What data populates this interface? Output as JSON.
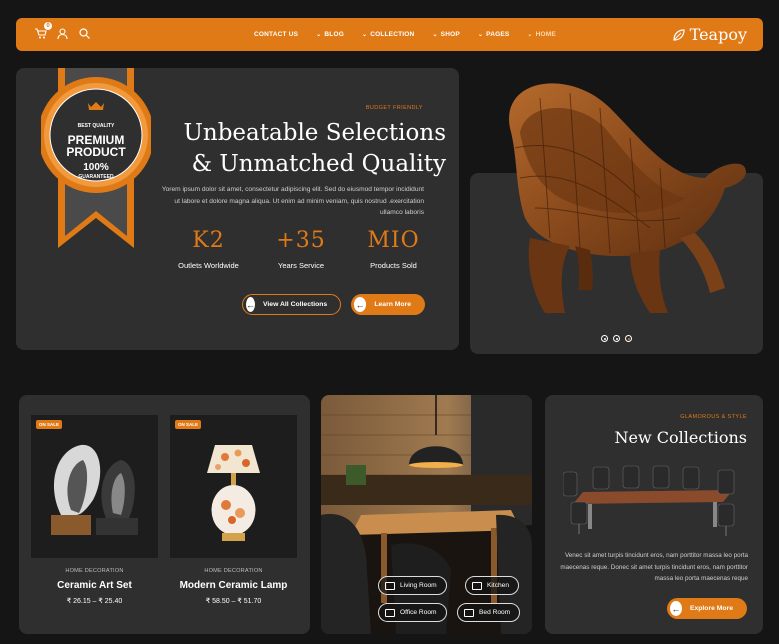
{
  "nav": {
    "cart_count": "0",
    "menu": [
      {
        "label": "CONTACT US",
        "has_dropdown": false
      },
      {
        "label": "BLOG",
        "has_dropdown": true
      },
      {
        "label": "COLLECTION",
        "has_dropdown": true
      },
      {
        "label": "SHOP",
        "has_dropdown": true
      },
      {
        "label": "PAGES",
        "has_dropdown": true
      },
      {
        "label": "HOME",
        "has_dropdown": true
      }
    ],
    "logo": "Teapoy"
  },
  "badge": {
    "top": "BEST QUALITY",
    "line1": "PREMIUM",
    "line2": "PRODUCT",
    "percent": "100%",
    "bottom": "GUARANTEED"
  },
  "hero": {
    "kicker": "BUDGET FRIENDLY",
    "title_line1": "Unbeatable Selections",
    "title_line2": "& Unmatched Quality",
    "description": "Yorem ipsum dolor sit amet, consectetur adipiscing elit. Sed do eiusmod tempor incididunt ut labore et dolore magna aliqua. Ut enim ad minim veniam, quis nostrud .exercitation ullamco laboris",
    "stats": [
      {
        "value": "K2",
        "label": "Outlets Worldwide"
      },
      {
        "value": "+35",
        "label": "Years Service"
      },
      {
        "value": "MIO",
        "label": "Products Sold"
      }
    ],
    "btn_collections": "View All Collections",
    "btn_learn": "Learn More"
  },
  "slider": {
    "slide_count": 3,
    "active_index": 2
  },
  "products": [
    {
      "sale": "ON SALE",
      "category": "HOME DECORATION",
      "name": "Ceramic Art Set",
      "price": "₹ 26.15 – ₹ 25.40"
    },
    {
      "sale": "ON SALE",
      "category": "HOME DECORATION",
      "name": "Modern Ceramic Lamp",
      "price": "₹ 58.50 – ₹ 51.70"
    }
  ],
  "room_tags": [
    "Living Room",
    "Kitchen",
    "Office Room",
    "Bed Room"
  ],
  "new_collections": {
    "kicker": "GLAMOROUS & STYLE",
    "title": "New Collections",
    "description": "Venec sit amet turpis tincidunt eros, nam porttitor massa leo porta maecenas reque. Donec sit amet turpis tincidunt eros, nam porttitor massa leo porta maecenas reque",
    "button": "Explore More"
  },
  "colors": {
    "accent": "#e07a17",
    "card": "#2f2f2f",
    "background": "#151515"
  }
}
